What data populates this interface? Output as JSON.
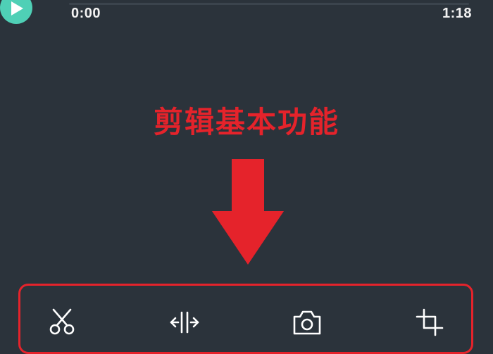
{
  "player": {
    "current_time": "0:00",
    "total_time": "1:18",
    "progress": 0
  },
  "annotation": {
    "title": "剪辑基本功能",
    "color": "#e5232b"
  },
  "toolbar": {
    "tools": [
      {
        "icon": "scissors-icon"
      },
      {
        "icon": "split-icon"
      },
      {
        "icon": "camera-icon"
      },
      {
        "icon": "crop-icon"
      }
    ]
  },
  "colors": {
    "background": "#2b333b",
    "accent": "#4fd0b6",
    "highlight": "#e5232b",
    "text": "#f2f2f2"
  }
}
